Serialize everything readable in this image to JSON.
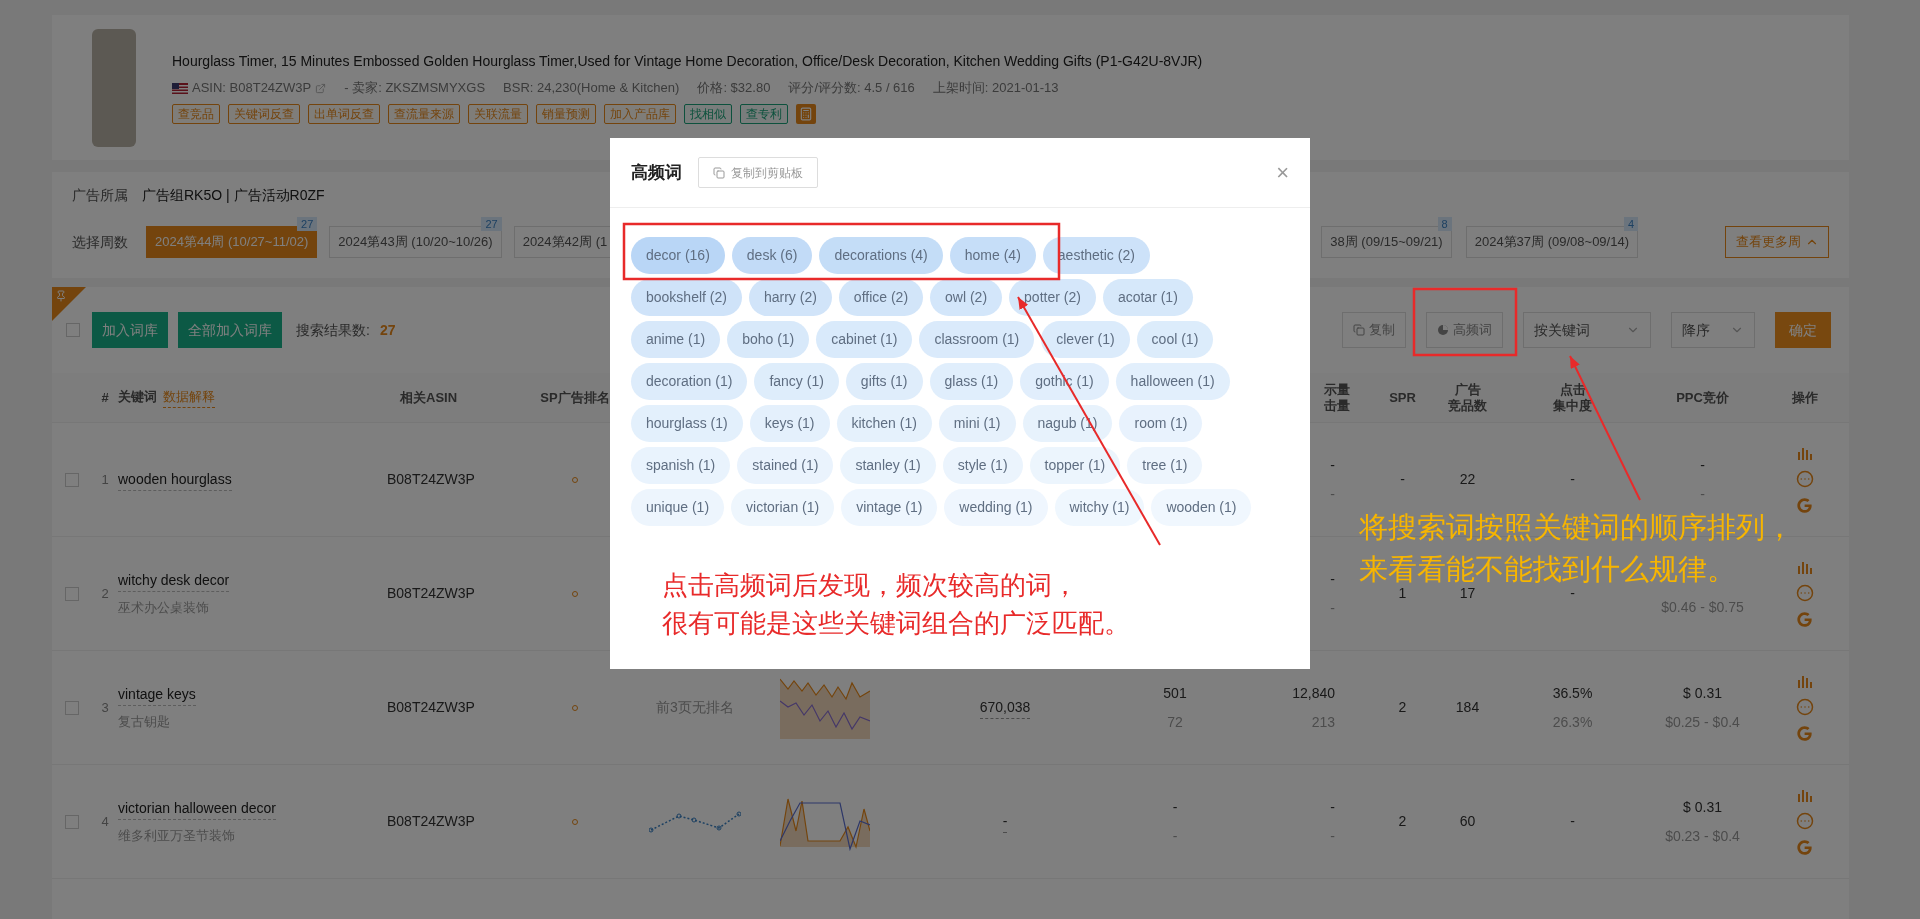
{
  "product": {
    "title": "Hourglass Timer, 15 Minutes Embossed Golden Hourglass Timer,Used for Vintage Home Decoration, Office/Desk Decoration, Kitchen Wedding Gifts (P1-G42U-8VJR)",
    "meta": [
      "ASIN: B08T24ZW3P",
      "- 卖家: ZKSZMSMYXGS",
      "BSR: 24,230(Home & Kitchen)",
      "价格: $32.80",
      "评分/评分数: 4.5 / 616",
      "上架时间: 2021-01-13"
    ],
    "tags": [
      {
        "label": "查竞品",
        "kind": "tool"
      },
      {
        "label": "关键词反查",
        "kind": "tool"
      },
      {
        "label": "出单词反查",
        "kind": "tool"
      },
      {
        "label": "查流量来源",
        "kind": "tool"
      },
      {
        "label": "关联流量",
        "kind": "tool"
      },
      {
        "label": "销量预测",
        "kind": "tool"
      },
      {
        "label": "加入产品库",
        "kind": "tool"
      },
      {
        "label": "找相似",
        "kind": "finder"
      },
      {
        "label": "查专利",
        "kind": "finder"
      }
    ]
  },
  "ad": {
    "label": "广告所属",
    "value": "广告组RK5O | 广告活动R0ZF",
    "weeks_label": "选择周数",
    "weeks": [
      {
        "label": "2024第44周 (10/27~11/02)",
        "badge": "27",
        "selected": true
      },
      {
        "label": "2024第43周 (10/20~10/26)",
        "badge": "27",
        "selected": false
      },
      {
        "label": "2024第42周 (1",
        "selected": false
      }
    ],
    "weeks_right": [
      {
        "label": "38周 (09/15~09/21)",
        "badge": "8",
        "selected": false
      },
      {
        "label": "2024第37周 (09/08~09/14)",
        "badge": "4",
        "selected": false
      }
    ],
    "more": "查看更多周"
  },
  "toolbar": {
    "select_all_checked": false,
    "add": "加入词库",
    "add_all": "全部加入词库",
    "count_label": "搜索结果数:",
    "count": "27",
    "copy": "复制",
    "high_freq": "高频词",
    "sort_by": "按关键词",
    "order": "降序",
    "confirm": "确定"
  },
  "header": {
    "index": "#",
    "keyword": "关键词",
    "hint": "数据解释",
    "asin": "相关ASIN",
    "sp_rank": "SP广告排名",
    "column_9": [
      "示量",
      "击量"
    ],
    "spr": "SPR",
    "competitors": [
      "广告",
      "竞品数"
    ],
    "click_share": [
      "点击",
      "集中度"
    ],
    "ppc": "PPC竞价",
    "actions": "操作"
  },
  "rows": [
    {
      "checked": false,
      "index": "1",
      "keyword": "wooden hourglass",
      "asin": "B08T24ZW3P",
      "column_9": [
        "-",
        "-"
      ],
      "spr": "-",
      "competitors": "22",
      "click_share": [
        "-"
      ],
      "ppc": "-",
      "ppc_range": "-"
    },
    {
      "checked": false,
      "index": "2",
      "keyword": "witchy desk decor",
      "translation": "巫术办公桌装饰",
      "asin": "B08T24ZW3P",
      "column_9": [
        "-",
        "-"
      ],
      "spr": "1",
      "competitors": "17",
      "click_share": [
        "-"
      ],
      "ppc_range": "$0.46 - $0.75"
    },
    {
      "checked": false,
      "index": "3",
      "keyword": "vintage keys",
      "translation": "复古钥匙",
      "asin": "B08T24ZW3P",
      "column_5": {
        "kind": "text",
        "text": "前3页无排名"
      },
      "column_6": {
        "kind": "area"
      },
      "column_7": "670,038",
      "column_8": [
        "501",
        "72"
      ],
      "column_9": [
        "12,840",
        "213"
      ],
      "spr": "2",
      "competitors": "184",
      "click_share": [
        "36.5%",
        "26.3%"
      ],
      "ppc": "$ 0.31",
      "ppc_range": "$0.25 - $0.4"
    },
    {
      "checked": false,
      "index": "4",
      "keyword": "victorian halloween decor",
      "translation": "维多利亚万圣节装饰",
      "asin": "B08T24ZW3P",
      "column_5": {
        "kind": "dotted"
      },
      "column_6": {
        "kind": "step"
      },
      "column_7": "-",
      "column_8": [
        "-",
        "-"
      ],
      "column_9": [
        "-",
        "-"
      ],
      "spr": "2",
      "competitors": "60",
      "click_share": [
        "-"
      ],
      "ppc": "$ 0.31",
      "ppc_range": "$0.23 - $0.4"
    }
  ],
  "modal": {
    "title": "高频词",
    "copy": "复制到剪贴板",
    "close": "×",
    "tag_rows": [
      [
        {
          "label": "decor (16)",
          "color": "#b9d6f6"
        },
        {
          "label": "desk (6)",
          "color": "#c2dbf7"
        },
        {
          "label": "decorations (4)",
          "color": "#c4ddf7"
        },
        {
          "label": "home (4)",
          "color": "#c6def8"
        },
        {
          "label": "aesthetic (2)",
          "color": "#cde2f9"
        }
      ],
      [
        {
          "label": "bookshelf (2)",
          "color": "#cfe3f9"
        },
        {
          "label": "harry (2)",
          "color": "#d1e4f9"
        },
        {
          "label": "office (2)",
          "color": "#d2e5f9"
        },
        {
          "label": "owl (2)",
          "color": "#d3e6fa"
        },
        {
          "label": "potter (2)",
          "color": "#d5e7fa"
        },
        {
          "label": "acotar (1)",
          "color": "#d6e8fa"
        }
      ],
      [
        {
          "label": "anime (1)",
          "color": "#d7e8fa"
        },
        {
          "label": "boho (1)",
          "color": "#d8e9fa"
        },
        {
          "label": "cabinet (1)",
          "color": "#d9eafb"
        },
        {
          "label": "classroom (1)",
          "color": "#daeafb"
        },
        {
          "label": "clever (1)",
          "color": "#dbebfb"
        },
        {
          "label": "cool (1)",
          "color": "#dcecfb"
        }
      ],
      [
        {
          "label": "decoration (1)",
          "color": "#ddecfb"
        },
        {
          "label": "fancy (1)",
          "color": "#deedfb"
        },
        {
          "label": "gifts (1)",
          "color": "#dfedfb"
        },
        {
          "label": "glass (1)",
          "color": "#e0eefc"
        },
        {
          "label": "gothic (1)",
          "color": "#e1eefc"
        },
        {
          "label": "halloween (1)",
          "color": "#e2effc"
        }
      ],
      [
        {
          "label": "hourglass (1)",
          "color": "#e3f0fc"
        },
        {
          "label": "keys (1)",
          "color": "#e4f0fc"
        },
        {
          "label": "kitchen (1)",
          "color": "#e5f1fc"
        },
        {
          "label": "mini (1)",
          "color": "#e6f1fc"
        },
        {
          "label": "nagub (1)",
          "color": "#e7f2fc"
        },
        {
          "label": "room (1)",
          "color": "#e8f2fd"
        }
      ],
      [
        {
          "label": "spanish (1)",
          "color": "#e9f3fd"
        },
        {
          "label": "stained (1)",
          "color": "#eaf3fd"
        },
        {
          "label": "stanley (1)",
          "color": "#eaf4fd"
        },
        {
          "label": "style (1)",
          "color": "#ebf4fd"
        },
        {
          "label": "topper (1)",
          "color": "#ecf5fd"
        },
        {
          "label": "tree (1)",
          "color": "#edf5fd"
        }
      ],
      [
        {
          "label": "unique (1)",
          "color": "#edf5fd"
        },
        {
          "label": "victorian (1)",
          "color": "#eef6fd"
        },
        {
          "label": "vintage (1)",
          "color": "#eef6fe"
        },
        {
          "label": "wedding (1)",
          "color": "#eff6fe"
        },
        {
          "label": "witchy (1)",
          "color": "#eff7fe"
        },
        {
          "label": "wooden (1)",
          "color": "#f0f7fe"
        }
      ]
    ]
  },
  "annotations": {
    "red_note": [
      "点击高频词后发现，频次较高的词，",
      "很有可能是这些关键词组合的广泛匹配。"
    ],
    "yellow_note": [
      "将搜索词按照关键词的顺序排列，",
      "来看看能不能找到什么规律。"
    ]
  }
}
